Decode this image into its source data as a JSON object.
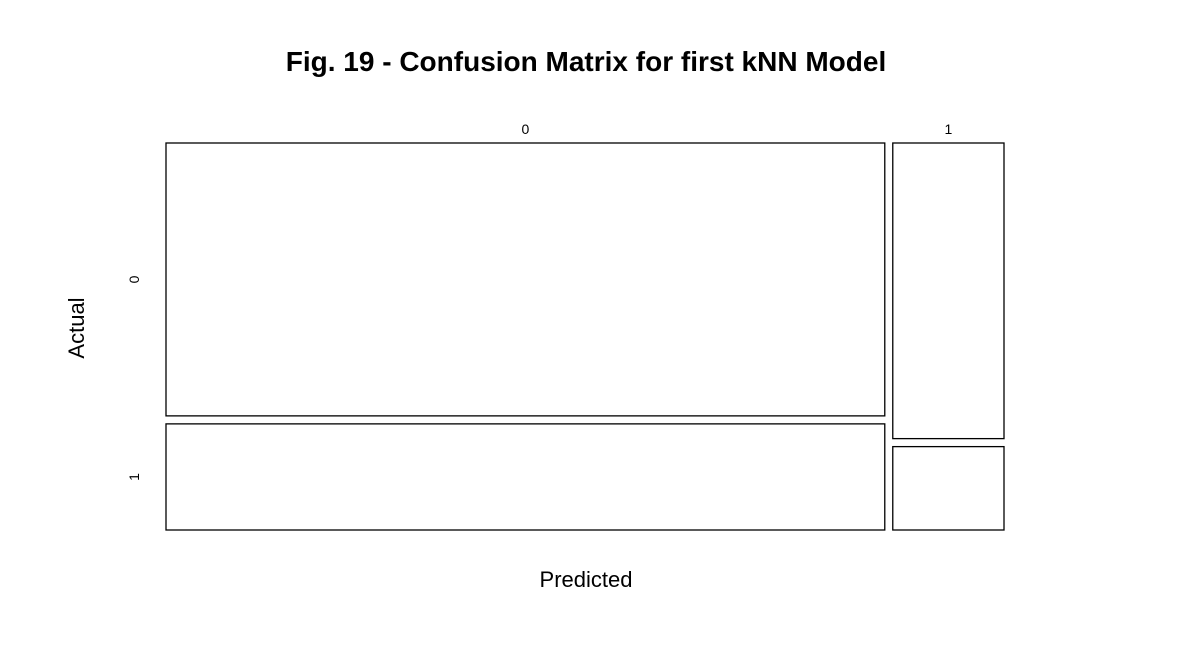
{
  "chart_data": {
    "type": "mosaic",
    "title": "Fig. 19 - Confusion Matrix for first kNN Model",
    "xlabel": "Predicted",
    "ylabel": "Actual",
    "x_categories": [
      "0",
      "1"
    ],
    "y_categories": [
      "0",
      "1"
    ],
    "column_proportions": [
      0.866,
      0.134
    ],
    "conditional_proportions": [
      {
        "predicted": "0",
        "actual_0": 0.72,
        "actual_1": 0.28
      },
      {
        "predicted": "1",
        "actual_0": 0.78,
        "actual_1": 0.22
      }
    ],
    "fill_color": "#ffffff",
    "stroke_color": "#000000",
    "grid": false,
    "legend": "none"
  }
}
